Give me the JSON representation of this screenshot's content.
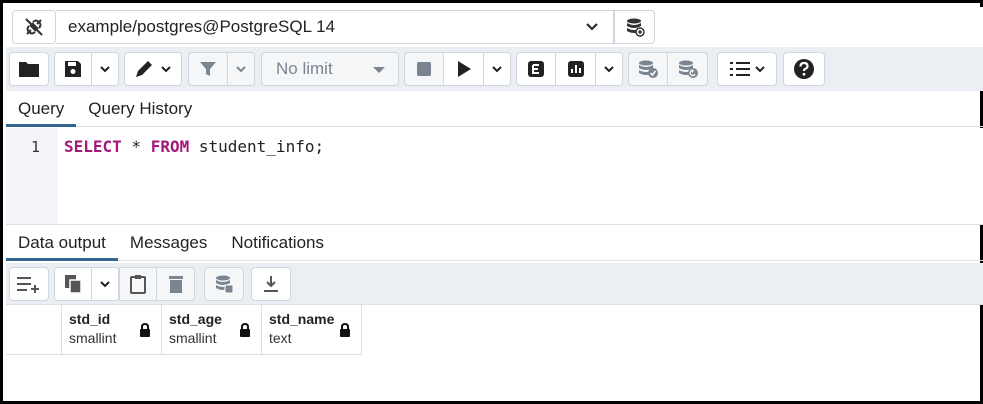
{
  "connection": {
    "label": "example/postgres@PostgreSQL 14"
  },
  "toolbar": {
    "limit_select": "No limit",
    "icons": [
      "folder-icon",
      "save-icon",
      "pen-icon",
      "filter-icon",
      "stop-icon",
      "play-icon",
      "explain-icon",
      "explain-analyze-icon",
      "commit-icon",
      "rollback-icon",
      "macros-icon",
      "help-icon"
    ]
  },
  "query_tabs": [
    {
      "label": "Query",
      "active": true
    },
    {
      "label": "Query History",
      "active": false
    }
  ],
  "editor": {
    "line_number": "1",
    "tokens": [
      {
        "text": "SELECT",
        "kw": true
      },
      {
        "text": " * ",
        "kw": false
      },
      {
        "text": "FROM",
        "kw": true
      },
      {
        "text": " student_info;",
        "kw": false
      }
    ]
  },
  "result_tabs": [
    {
      "label": "Data output",
      "active": true
    },
    {
      "label": "Messages",
      "active": false
    },
    {
      "label": "Notifications",
      "active": false
    }
  ],
  "columns": [
    {
      "name": "std_id",
      "type": "smallint"
    },
    {
      "name": "std_age",
      "type": "smallint"
    },
    {
      "name": "std_name",
      "type": "text"
    }
  ],
  "colors": {
    "accent": "#326690",
    "keyword": "#a3187b",
    "toolbar_bg": "#ebeef3"
  }
}
